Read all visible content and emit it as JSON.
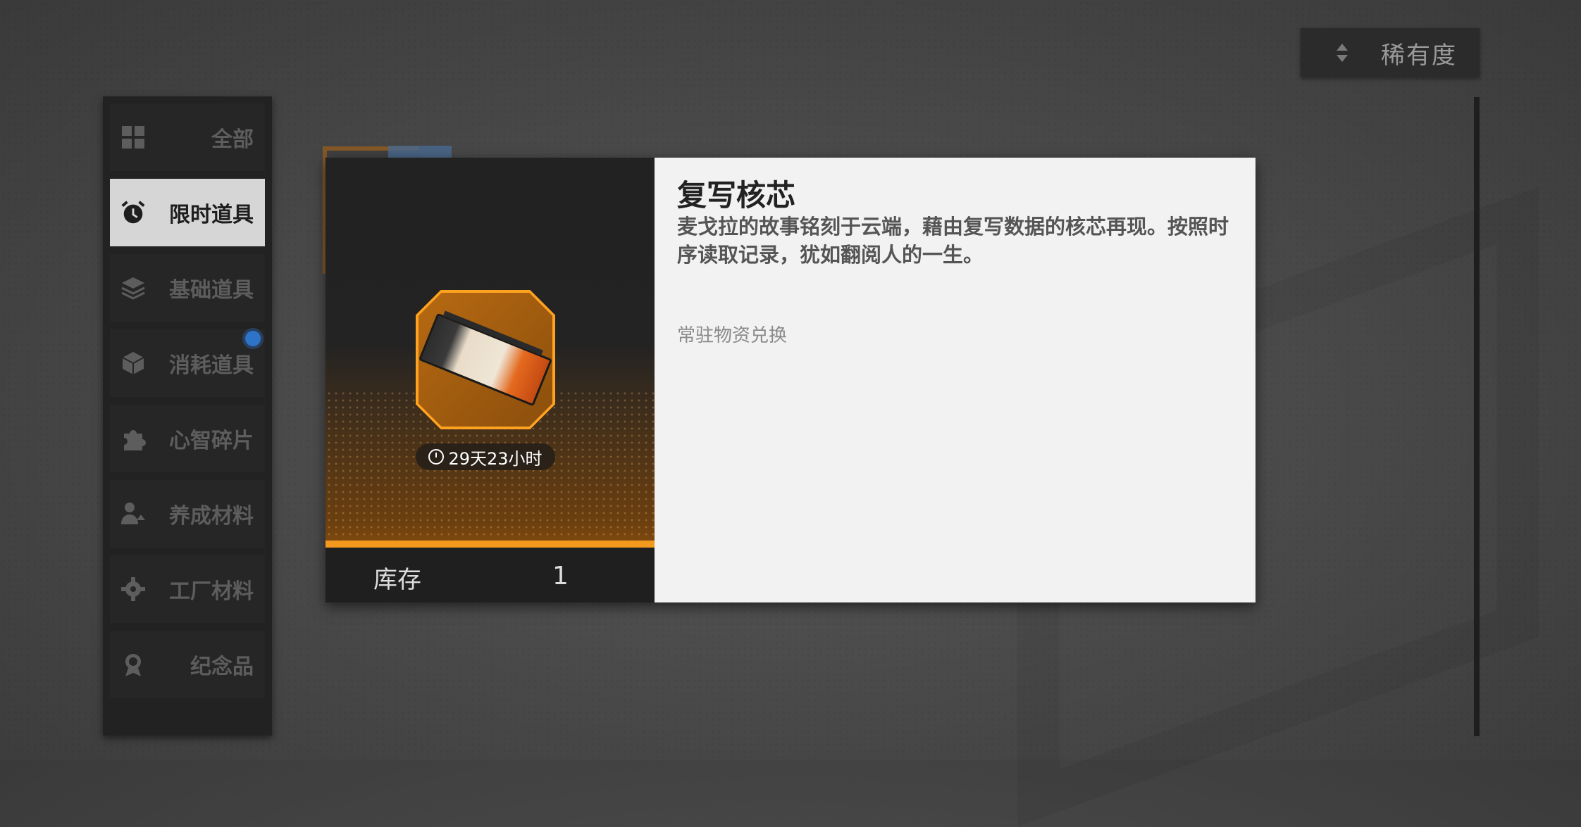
{
  "sort": {
    "label": "稀有度",
    "icon": "sort-arrows-icon"
  },
  "sidebar": {
    "items": [
      {
        "label": "全部",
        "icon": "grid-icon",
        "active": false
      },
      {
        "label": "限时道具",
        "icon": "alarm-clock-icon",
        "active": true
      },
      {
        "label": "基础道具",
        "icon": "layers-icon",
        "active": false
      },
      {
        "label": "消耗道具",
        "icon": "box-icon",
        "active": false
      },
      {
        "label": "心智碎片",
        "icon": "puzzle-icon",
        "active": false
      },
      {
        "label": "养成材料",
        "icon": "user-upgrade-icon",
        "active": false
      },
      {
        "label": "工厂材料",
        "icon": "gear-icon",
        "active": false
      },
      {
        "label": "纪念品",
        "icon": "medal-icon",
        "active": false
      }
    ]
  },
  "item": {
    "name": "复写核芯",
    "description": "麦戈拉的故事铭刻于云端，藉由复写数据的核芯再现。按照时序读取记录，犹如翻阅人的一生。",
    "source": "常驻物资兑换",
    "timer": "29天23小时",
    "stock_label": "库存",
    "stock_value": "1"
  },
  "colors": {
    "accent": "#f39a1e",
    "active_bg": "#d6d6d6",
    "panel": "#222222"
  }
}
